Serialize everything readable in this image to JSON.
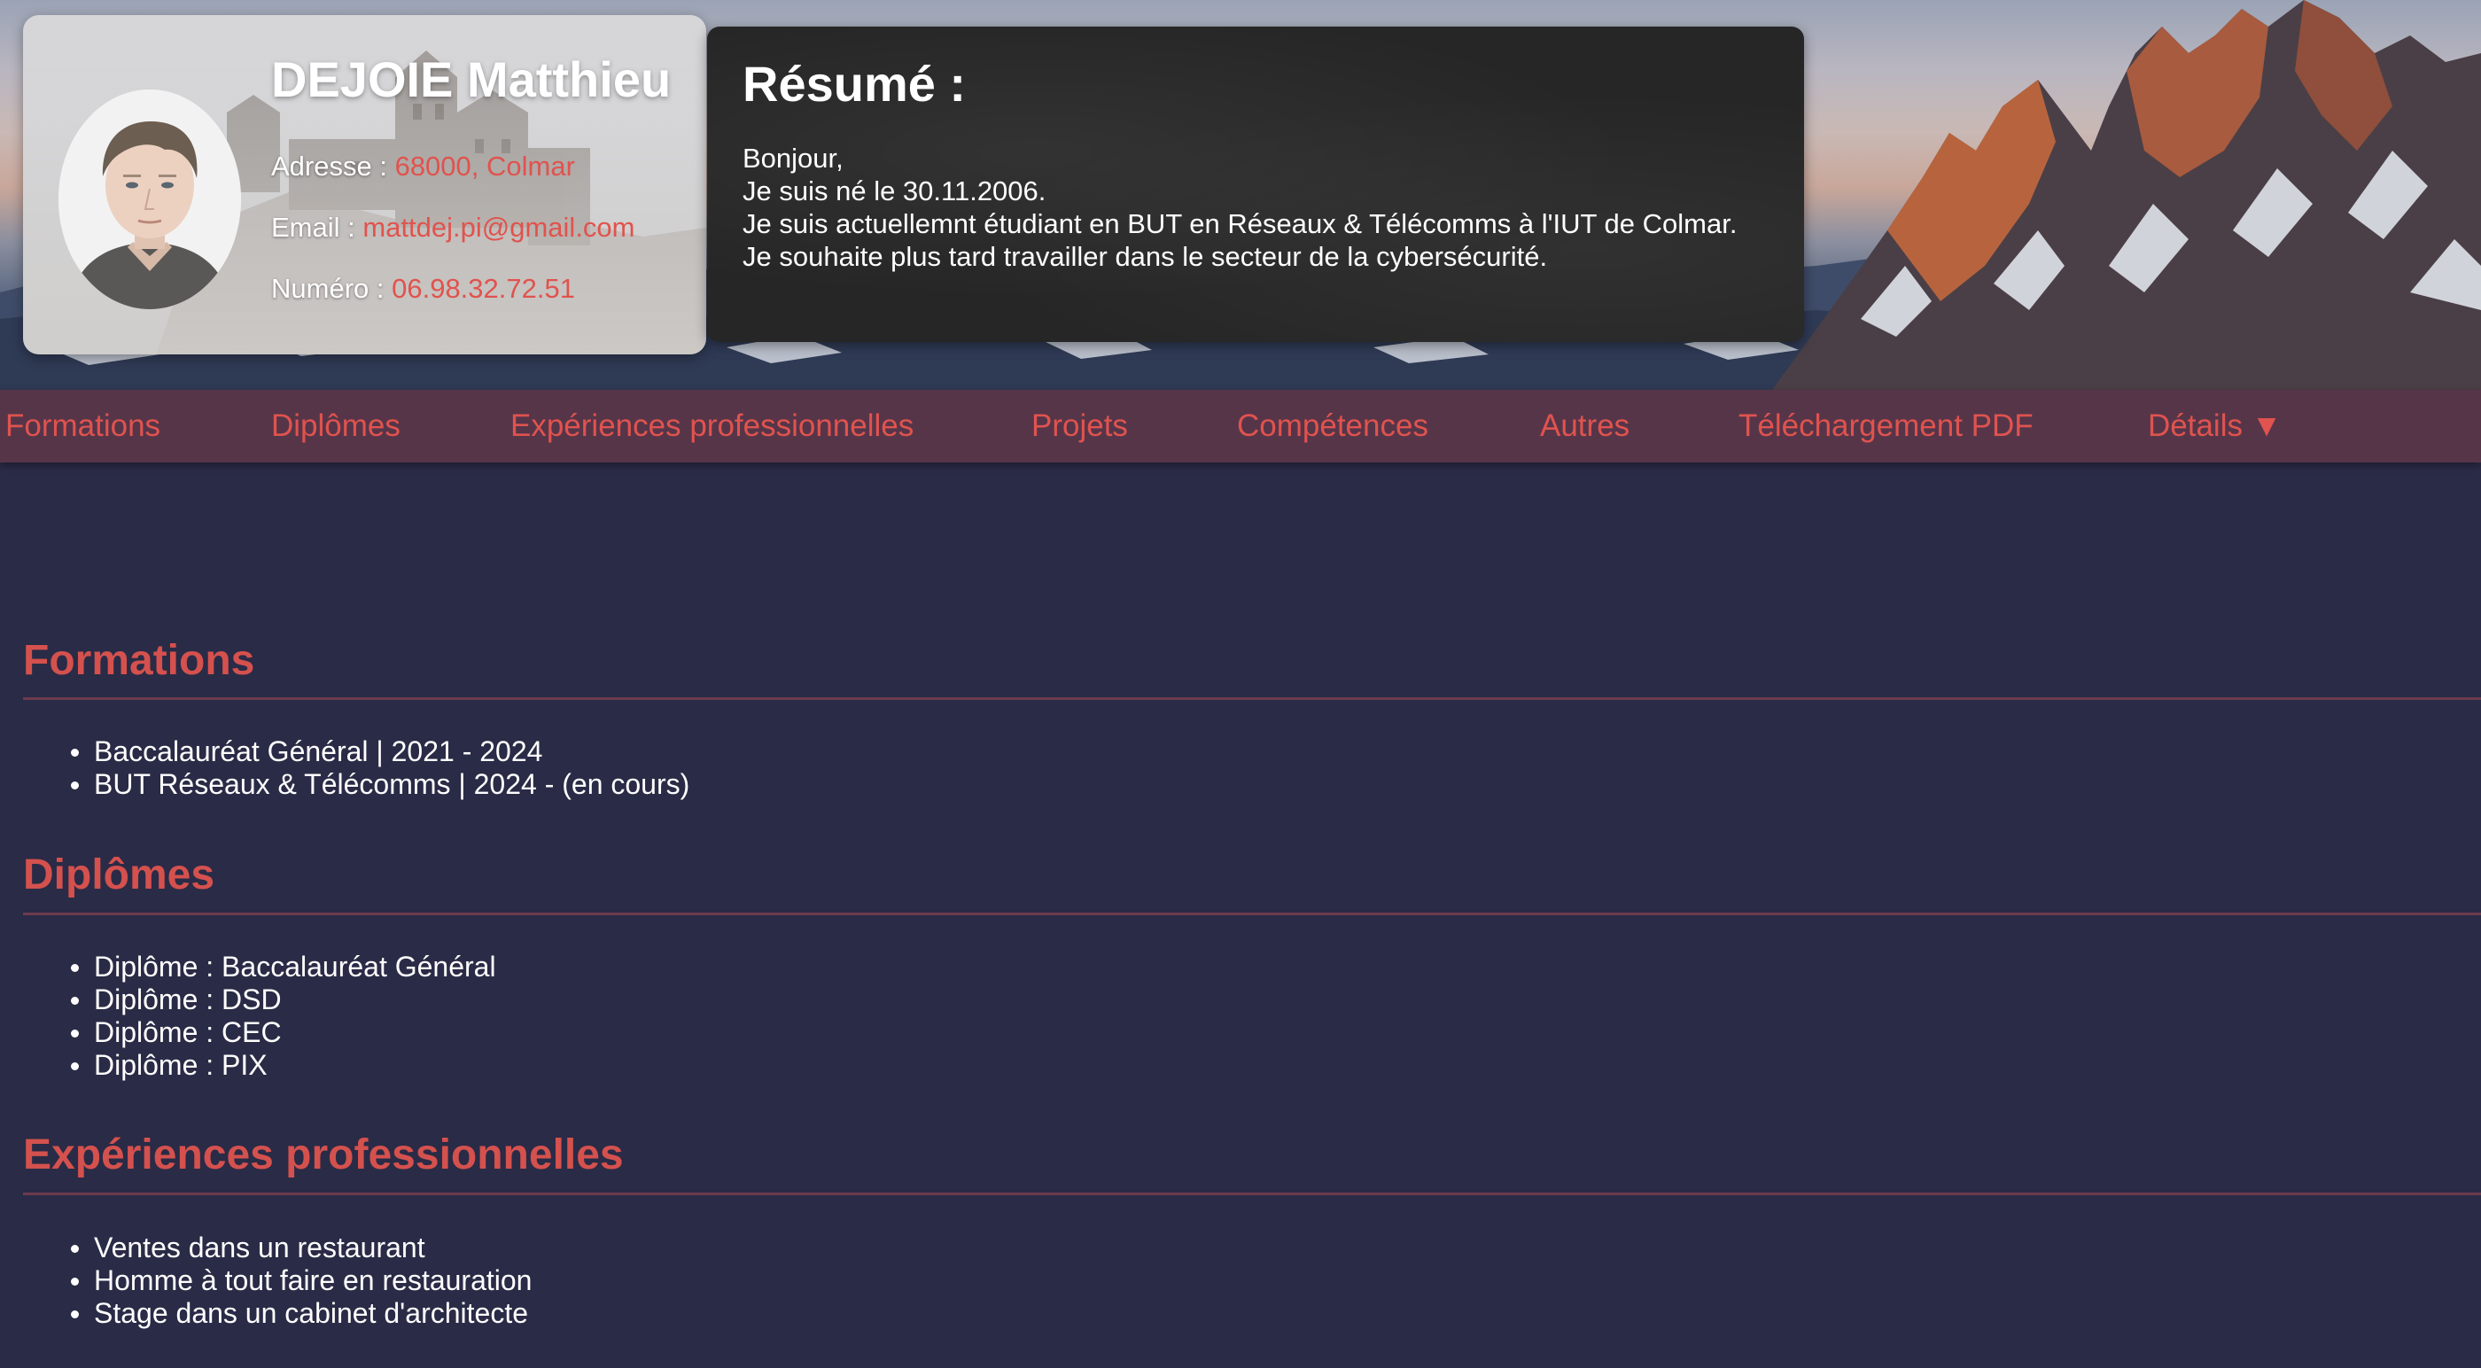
{
  "profile": {
    "name": "DEJOIE Matthieu",
    "address_label": "Adresse :",
    "address_value": "68000, Colmar",
    "email_label": "Email :",
    "email_value": "mattdej.pi@gmail.com",
    "phone_label": "Numéro :",
    "phone_value": "06.98.32.72.51"
  },
  "resume": {
    "title": "Résumé :",
    "lines": [
      "Bonjour,",
      "Je suis né le 30.11.2006.",
      "Je suis actuellemnt étudiant en BUT en Réseaux & Télécomms à l'IUT de Colmar.",
      "Je souhaite plus tard travailler dans le secteur de la cybersécurité."
    ]
  },
  "nav": {
    "items": [
      "Formations",
      "Diplômes",
      "Expériences professionnelles",
      "Projets",
      "Compétences",
      "Autres",
      "Téléchargement PDF",
      "Détails ▼"
    ]
  },
  "sections": {
    "formations": {
      "title": "Formations",
      "items": [
        "Baccalauréat Général | 2021 - 2024",
        "BUT Réseaux & Télécomms | 2024 - (en cours)"
      ]
    },
    "diplomes": {
      "title": "Diplômes",
      "items": [
        "Diplôme : Baccalauréat Général",
        "Diplôme : DSD",
        "Diplôme : CEC",
        "Diplôme : PIX"
      ]
    },
    "experiences": {
      "title": "Expériences professionnelles",
      "items": [
        "Ventes dans un restaurant",
        "Homme à tout faire en restauration",
        "Stage dans un cabinet d'architecte"
      ]
    }
  },
  "colors": {
    "background": "#2a2b46",
    "accent": "#e0534e",
    "nav_background": "#563549",
    "section_rule": "#6d3b4d",
    "chalkboard": "#262626"
  },
  "icons": {
    "avatar": "person-portrait",
    "header_background": "mountain-landscape",
    "card_background": "castle-in-fog"
  }
}
